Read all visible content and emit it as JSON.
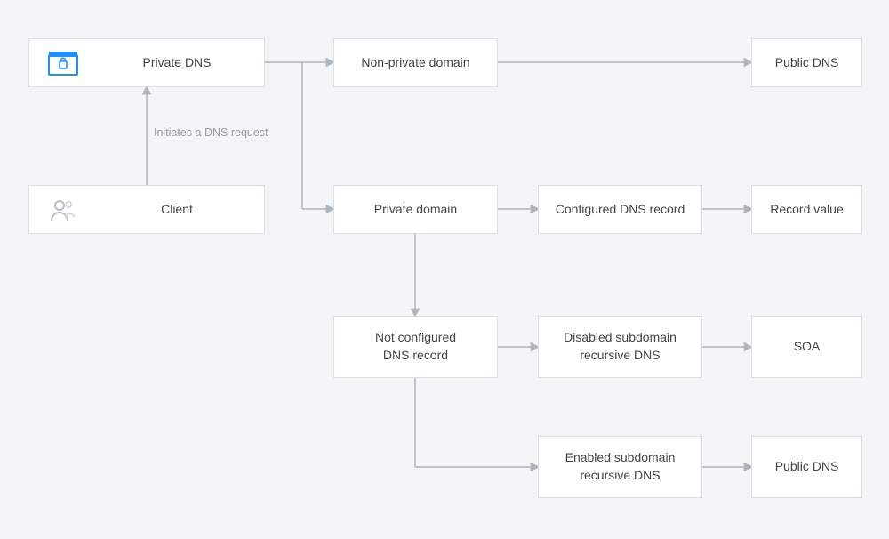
{
  "nodes": {
    "private_dns": "Private DNS",
    "client": "Client",
    "non_private_domain": "Non-private domain",
    "public_dns_top": "Public DNS",
    "private_domain": "Private domain",
    "configured_record": "Configured DNS record",
    "record_value": "Record value",
    "not_configured": "Not configured\nDNS record",
    "disabled_recursive": "Disabled subdomain\nrecursive DNS",
    "soa": "SOA",
    "enabled_recursive": "Enabled subdomain\nrecursive DNS",
    "public_dns_bottom": "Public DNS"
  },
  "edges": {
    "client_to_privatedns": "Initiates a DNS request"
  },
  "colors": {
    "accent": "#1e90ff",
    "border": "#dcdfe6",
    "arrow": "#b0b4bb",
    "text_muted": "#999"
  }
}
